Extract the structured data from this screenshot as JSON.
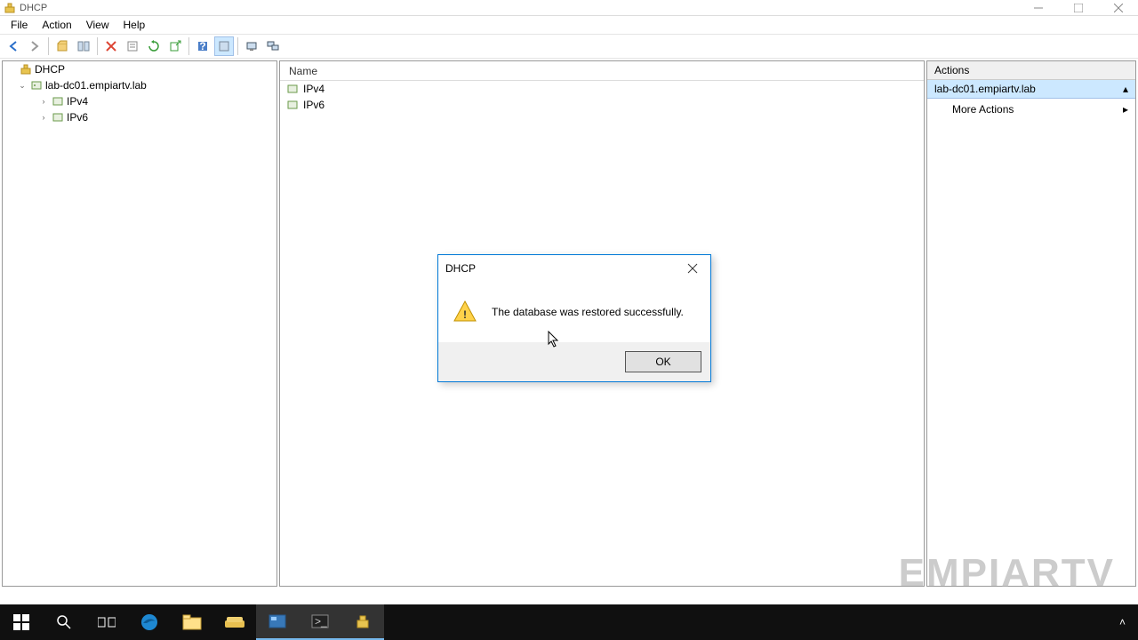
{
  "window": {
    "title": "DHCP"
  },
  "menu": {
    "file": "File",
    "action": "Action",
    "view": "View",
    "help": "Help"
  },
  "tree": {
    "root": "DHCP",
    "server": "lab-dc01.empiartv.lab",
    "ipv4": "IPv4",
    "ipv6": "IPv6"
  },
  "list": {
    "header_name": "Name",
    "items": {
      "0": "IPv4",
      "1": "IPv6"
    }
  },
  "actions": {
    "header": "Actions",
    "target": "lab-dc01.empiartv.lab",
    "more": "More Actions"
  },
  "dialog": {
    "title": "DHCP",
    "message": "The database was restored successfully.",
    "ok": "OK"
  },
  "watermark": "EMPIARTV"
}
